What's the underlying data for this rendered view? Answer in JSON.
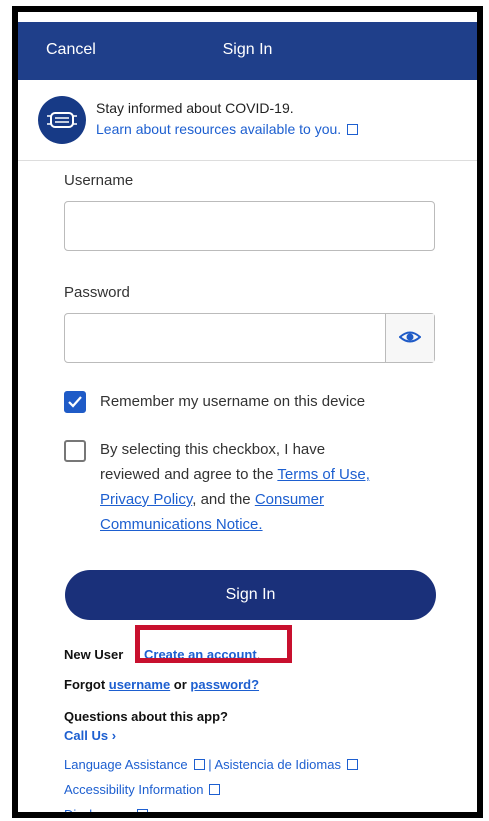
{
  "header": {
    "cancel_label": "Cancel",
    "title": "Sign In"
  },
  "covid_banner": {
    "icon": "face-mask-icon",
    "text": "Stay informed about COVID-19.",
    "link": "Learn about resources available to you."
  },
  "form": {
    "username_label": "Username",
    "username_value": "",
    "password_label": "Password",
    "password_value": "",
    "show_password_icon": "eye-icon",
    "remember": {
      "label": "Remember my username on this device",
      "checked": true
    },
    "agree": {
      "checked": false,
      "text_1": "By selecting this checkbox, I have",
      "text_2": "reviewed and agree to the ",
      "terms_link": "Terms of Use,",
      "privacy_link": "Privacy Policy",
      "text_3": ", and the ",
      "consumer_link": "Consumer",
      "communications_link": "Communications Notice."
    },
    "sign_in_button": "Sign In"
  },
  "footer": {
    "new_user_label": "New User",
    "create_account_link": "Create an account",
    "create_account_period": ".",
    "forgot_label": "Forgot ",
    "username_link": "username",
    "or_label": " or ",
    "password_link": "password?",
    "questions_label": "Questions about this app?",
    "call_us_link": "Call Us",
    "call_us_chevron": "›",
    "language_link": "Language Assistance",
    "separator": " | ",
    "spanish_link": "Asistencia de Idiomas",
    "accessibility_link": "Accessibility Information",
    "disclosures_link": "Disclosures"
  },
  "colors": {
    "header_bg": "#1f3f8a",
    "button_bg": "#1a307a",
    "link": "#1d5fd0",
    "highlight": "#c8102e"
  }
}
